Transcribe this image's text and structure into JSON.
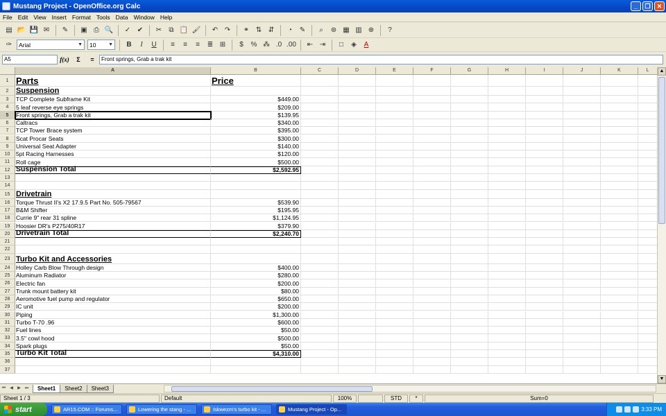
{
  "window": {
    "title": "Mustang Project - OpenOffice.org Calc"
  },
  "menu": [
    "File",
    "Edit",
    "View",
    "Insert",
    "Format",
    "Tools",
    "Data",
    "Window",
    "Help"
  ],
  "format_bar": {
    "font_name": "Arial",
    "font_size": "10"
  },
  "formula_bar": {
    "cell_ref": "A5",
    "content": "Front springs, Grab a trak kit",
    "sum_symbol": "Σ",
    "equals_symbol": "="
  },
  "columns": [
    "A",
    "B",
    "C",
    "D",
    "E",
    "F",
    "G",
    "H",
    "I",
    "J",
    "K",
    "L"
  ],
  "rows": [
    {
      "n": "1",
      "a": "Parts",
      "b": "Price",
      "style": "h1"
    },
    {
      "n": "2",
      "a": "Suspension",
      "b": "",
      "style": "h2"
    },
    {
      "n": "3",
      "a": "TCP Complete Subframe Kit",
      "b": "$449.00"
    },
    {
      "n": "4",
      "a": "5 leaf reverse eye springs",
      "b": "$209.00"
    },
    {
      "n": "5",
      "a": "Front springs, Grab a trak kit",
      "b": "$139.95",
      "selected": true
    },
    {
      "n": "6",
      "a": "Caltracs",
      "b": "$340.00"
    },
    {
      "n": "7",
      "a": "TCP Tower Brace system",
      "b": "$395.00"
    },
    {
      "n": "8",
      "a": "Scat Procar Seats",
      "b": "$300.00"
    },
    {
      "n": "9",
      "a": "Universal Seat Adapter",
      "b": "$140.00"
    },
    {
      "n": "10",
      "a": "5pt Racing Harnesses",
      "b": "$120.00"
    },
    {
      "n": "11",
      "a": "Roll cage",
      "b": "$500.00"
    },
    {
      "n": "12",
      "a": "Suspension Total",
      "b": "$2,592.95",
      "style": "total"
    },
    {
      "n": "13",
      "a": "",
      "b": ""
    },
    {
      "n": "14",
      "a": "",
      "b": ""
    },
    {
      "n": "15",
      "a": "Drivetrain",
      "b": "",
      "style": "h2"
    },
    {
      "n": "16",
      "a": "Torque Thrust II's X2 17.9.5 Part No. 505-79567",
      "b": "$539.90"
    },
    {
      "n": "17",
      "a": "B&M Shifter",
      "b": "$195.95"
    },
    {
      "n": "18",
      "a": "Currie 9\" rear 31 spline",
      "b": "$1,124.95"
    },
    {
      "n": "19",
      "a": "Hoosier DR's P275/40R17",
      "b": "$379.90"
    },
    {
      "n": "20",
      "a": "Drivetrain Total",
      "b": "$2,240.70",
      "style": "total"
    },
    {
      "n": "21",
      "a": "",
      "b": ""
    },
    {
      "n": "22",
      "a": "",
      "b": ""
    },
    {
      "n": "23",
      "a": "Turbo Kit and Accessories",
      "b": "",
      "style": "h2t"
    },
    {
      "n": "24",
      "a": "Holley Carb Blow Through design",
      "b": "$400.00"
    },
    {
      "n": "25",
      "a": "Aluminum Radiator",
      "b": "$280.00"
    },
    {
      "n": "26",
      "a": "Electric fan",
      "b": "$200.00"
    },
    {
      "n": "27",
      "a": "Trunk mount battery kit",
      "b": "$80.00"
    },
    {
      "n": "28",
      "a": "Aeromotive fuel pump and regulator",
      "b": "$650.00"
    },
    {
      "n": "29",
      "a": "IC unit",
      "b": "$200.00"
    },
    {
      "n": "30",
      "a": "Piping",
      "b": "$1,300.00"
    },
    {
      "n": "31",
      "a": "Turbo T-70 .96",
      "b": "$600.00"
    },
    {
      "n": "32",
      "a": "Fuel lines",
      "b": "$50.00"
    },
    {
      "n": "33",
      "a": "3.5\" cowl hood",
      "b": "$500.00"
    },
    {
      "n": "34",
      "a": "Spark plugs",
      "b": "$50.00"
    },
    {
      "n": "35",
      "a": "Turbo Kit Total",
      "b": "$4,310.00",
      "style": "total"
    },
    {
      "n": "36",
      "a": "",
      "b": ""
    },
    {
      "n": "37",
      "a": "",
      "b": ""
    }
  ],
  "sheet_tabs": [
    "Sheet1",
    "Sheet2",
    "Sheet3"
  ],
  "status": {
    "sheet": "Sheet 1 / 3",
    "style": "Default",
    "zoom": "100%",
    "mode": "STD",
    "modified": "*",
    "sum": "Sum=0"
  },
  "taskbar": {
    "start": "start",
    "tasks": [
      "AR15.COM :: Forums...",
      "Lowering the stang - ...",
      "Iskwezm's turbo kit - ...",
      "Mustang Project - Op..."
    ],
    "clock": "3:33 PM"
  }
}
